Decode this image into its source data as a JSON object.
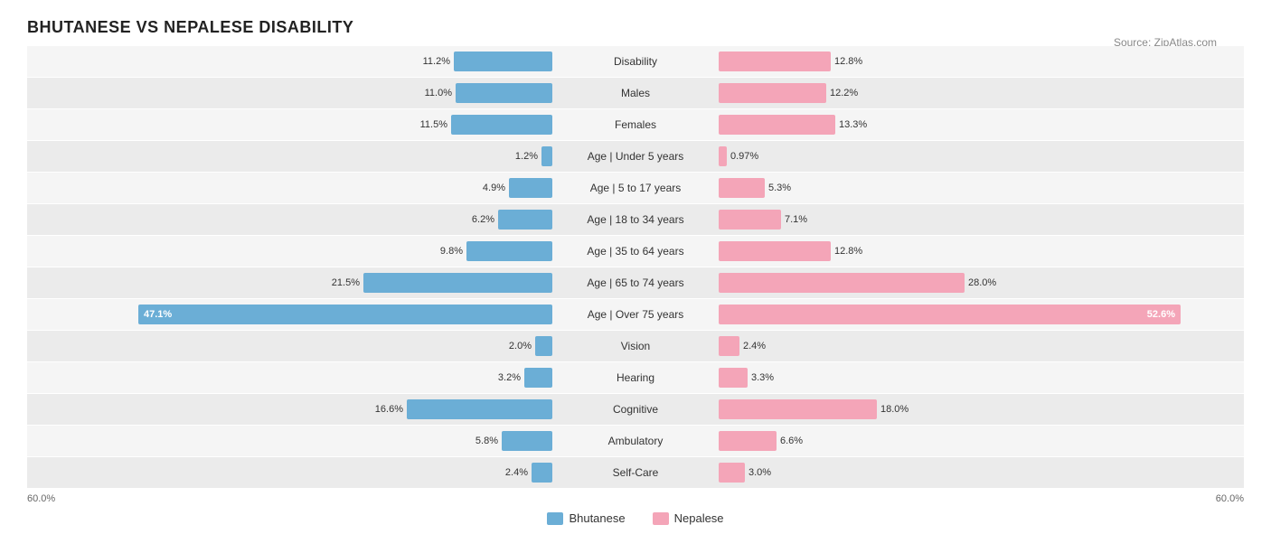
{
  "title": "BHUTANESE VS NEPALESE DISABILITY",
  "source": "Source: ZipAtlas.com",
  "legend": {
    "bhutanese_label": "Bhutanese",
    "nepalese_label": "Nepalese",
    "bhutanese_color": "#6baed6",
    "nepalese_color": "#f4a5b8"
  },
  "xaxis": {
    "left": "60.0%",
    "right": "60.0%"
  },
  "rows": [
    {
      "label": "Disability",
      "left_val": "11.2%",
      "right_val": "12.8%",
      "left_pct": 11.2,
      "right_pct": 12.8,
      "left_inside": false,
      "right_inside": false
    },
    {
      "label": "Males",
      "left_val": "11.0%",
      "right_val": "12.2%",
      "left_pct": 11.0,
      "right_pct": 12.2,
      "left_inside": false,
      "right_inside": false
    },
    {
      "label": "Females",
      "left_val": "11.5%",
      "right_val": "13.3%",
      "left_pct": 11.5,
      "right_pct": 13.3,
      "left_inside": false,
      "right_inside": false
    },
    {
      "label": "Age | Under 5 years",
      "left_val": "1.2%",
      "right_val": "0.97%",
      "left_pct": 1.2,
      "right_pct": 0.97,
      "left_inside": false,
      "right_inside": false
    },
    {
      "label": "Age | 5 to 17 years",
      "left_val": "4.9%",
      "right_val": "5.3%",
      "left_pct": 4.9,
      "right_pct": 5.3,
      "left_inside": false,
      "right_inside": false
    },
    {
      "label": "Age | 18 to 34 years",
      "left_val": "6.2%",
      "right_val": "7.1%",
      "left_pct": 6.2,
      "right_pct": 7.1,
      "left_inside": false,
      "right_inside": false
    },
    {
      "label": "Age | 35 to 64 years",
      "left_val": "9.8%",
      "right_val": "12.8%",
      "left_pct": 9.8,
      "right_pct": 12.8,
      "left_inside": false,
      "right_inside": false
    },
    {
      "label": "Age | 65 to 74 years",
      "left_val": "21.5%",
      "right_val": "28.0%",
      "left_pct": 21.5,
      "right_pct": 28.0,
      "left_inside": false,
      "right_inside": false
    },
    {
      "label": "Age | Over 75 years",
      "left_val": "47.1%",
      "right_val": "52.6%",
      "left_pct": 47.1,
      "right_pct": 52.6,
      "left_inside": true,
      "right_inside": true
    },
    {
      "label": "Vision",
      "left_val": "2.0%",
      "right_val": "2.4%",
      "left_pct": 2.0,
      "right_pct": 2.4,
      "left_inside": false,
      "right_inside": false
    },
    {
      "label": "Hearing",
      "left_val": "3.2%",
      "right_val": "3.3%",
      "left_pct": 3.2,
      "right_pct": 3.3,
      "left_inside": false,
      "right_inside": false
    },
    {
      "label": "Cognitive",
      "left_val": "16.6%",
      "right_val": "18.0%",
      "left_pct": 16.6,
      "right_pct": 18.0,
      "left_inside": false,
      "right_inside": false
    },
    {
      "label": "Ambulatory",
      "left_val": "5.8%",
      "right_val": "6.6%",
      "left_pct": 5.8,
      "right_pct": 6.6,
      "left_inside": false,
      "right_inside": false
    },
    {
      "label": "Self-Care",
      "left_val": "2.4%",
      "right_val": "3.0%",
      "left_pct": 2.4,
      "right_pct": 3.0,
      "left_inside": false,
      "right_inside": false
    }
  ]
}
